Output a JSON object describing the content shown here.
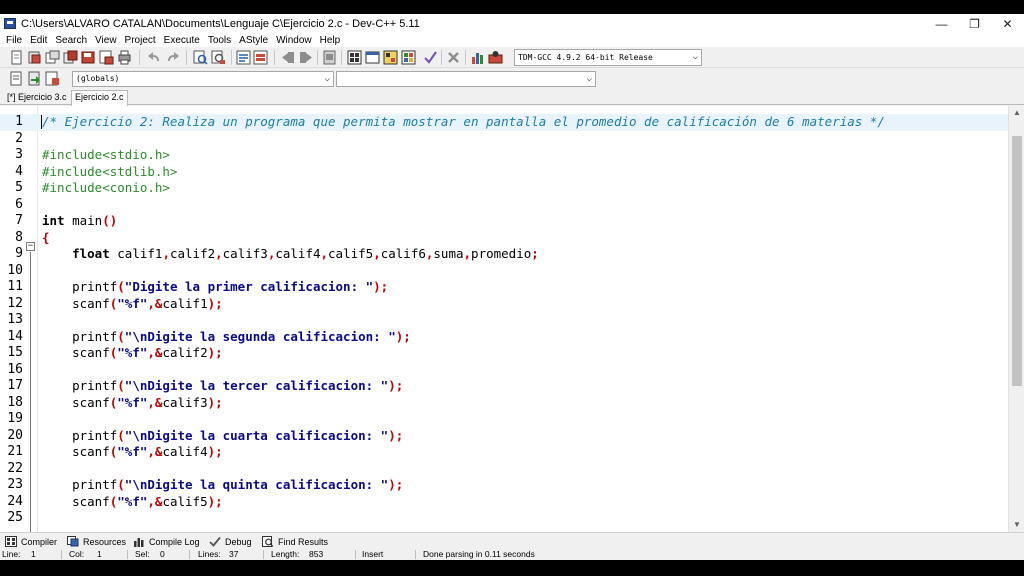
{
  "window": {
    "title": "C:\\Users\\ALVARO CATALAN\\Documents\\Lenguaje C\\Ejercicio 2.c - Dev-C++ 5.11",
    "minimize": "—",
    "maximize": "❐",
    "close": "✕"
  },
  "menu": [
    "File",
    "Edit",
    "Search",
    "View",
    "Project",
    "Execute",
    "Tools",
    "AStyle",
    "Window",
    "Help"
  ],
  "toolbar": {
    "compiler": "TDM-GCC 4.9.2 64-bit Release",
    "scope_combo": "(globals)",
    "member_combo": ""
  },
  "tabs": [
    {
      "label": "[*] Ejercicio 3.c",
      "active": false
    },
    {
      "label": "Ejercicio 2.c",
      "active": true
    }
  ],
  "editor": {
    "current_line": 1,
    "lines": [
      {
        "n": "1",
        "segs": [
          [
            "comment",
            "/* Ejercicio 2: Realiza un programa que permita mostrar en pantalla el promedio de calificación de 6 materias */"
          ]
        ]
      },
      {
        "n": "2",
        "segs": []
      },
      {
        "n": "3",
        "segs": [
          [
            "prep",
            "#include<stdio.h>"
          ]
        ]
      },
      {
        "n": "4",
        "segs": [
          [
            "prep",
            "#include<stdlib.h>"
          ]
        ]
      },
      {
        "n": "5",
        "segs": [
          [
            "prep",
            "#include<conio.h>"
          ]
        ]
      },
      {
        "n": "6",
        "segs": []
      },
      {
        "n": "7",
        "segs": [
          [
            "kw",
            "int"
          ],
          [
            "plain",
            " main"
          ],
          [
            "sym",
            "()"
          ]
        ]
      },
      {
        "n": "8",
        "segs": [
          [
            "sym",
            "{"
          ]
        ]
      },
      {
        "n": "9",
        "segs": [
          [
            "plain",
            "    "
          ],
          [
            "kw",
            "float"
          ],
          [
            "plain",
            " calif1"
          ],
          [
            "sym",
            ","
          ],
          [
            "plain",
            "calif2"
          ],
          [
            "sym",
            ","
          ],
          [
            "plain",
            "calif3"
          ],
          [
            "sym",
            ","
          ],
          [
            "plain",
            "calif4"
          ],
          [
            "sym",
            ","
          ],
          [
            "plain",
            "calif5"
          ],
          [
            "sym",
            ","
          ],
          [
            "plain",
            "calif6"
          ],
          [
            "sym",
            ","
          ],
          [
            "plain",
            "suma"
          ],
          [
            "sym",
            ","
          ],
          [
            "plain",
            "promedio"
          ],
          [
            "sym",
            ";"
          ]
        ]
      },
      {
        "n": "10",
        "segs": []
      },
      {
        "n": "11",
        "segs": [
          [
            "plain",
            "    printf"
          ],
          [
            "sym",
            "("
          ],
          [
            "str",
            "\"Digite la primer calificacion: \""
          ],
          [
            "sym",
            ");"
          ]
        ]
      },
      {
        "n": "12",
        "segs": [
          [
            "plain",
            "    scanf"
          ],
          [
            "sym",
            "("
          ],
          [
            "str",
            "\"%f\""
          ],
          [
            "sym",
            ",&"
          ],
          [
            "plain",
            "calif1"
          ],
          [
            "sym",
            ");"
          ]
        ]
      },
      {
        "n": "13",
        "segs": []
      },
      {
        "n": "14",
        "segs": [
          [
            "plain",
            "    printf"
          ],
          [
            "sym",
            "("
          ],
          [
            "str",
            "\"\\nDigite la segunda calificacion: \""
          ],
          [
            "sym",
            ");"
          ]
        ]
      },
      {
        "n": "15",
        "segs": [
          [
            "plain",
            "    scanf"
          ],
          [
            "sym",
            "("
          ],
          [
            "str",
            "\"%f\""
          ],
          [
            "sym",
            ",&"
          ],
          [
            "plain",
            "calif2"
          ],
          [
            "sym",
            ");"
          ]
        ]
      },
      {
        "n": "16",
        "segs": []
      },
      {
        "n": "17",
        "segs": [
          [
            "plain",
            "    printf"
          ],
          [
            "sym",
            "("
          ],
          [
            "str",
            "\"\\nDigite la tercer calificacion: \""
          ],
          [
            "sym",
            ");"
          ]
        ]
      },
      {
        "n": "18",
        "segs": [
          [
            "plain",
            "    scanf"
          ],
          [
            "sym",
            "("
          ],
          [
            "str",
            "\"%f\""
          ],
          [
            "sym",
            ",&"
          ],
          [
            "plain",
            "calif3"
          ],
          [
            "sym",
            ");"
          ]
        ]
      },
      {
        "n": "19",
        "segs": []
      },
      {
        "n": "20",
        "segs": [
          [
            "plain",
            "    printf"
          ],
          [
            "sym",
            "("
          ],
          [
            "str",
            "\"\\nDigite la cuarta calificacion: \""
          ],
          [
            "sym",
            ");"
          ]
        ]
      },
      {
        "n": "21",
        "segs": [
          [
            "plain",
            "    scanf"
          ],
          [
            "sym",
            "("
          ],
          [
            "str",
            "\"%f\""
          ],
          [
            "sym",
            ",&"
          ],
          [
            "plain",
            "calif4"
          ],
          [
            "sym",
            ");"
          ]
        ]
      },
      {
        "n": "22",
        "segs": []
      },
      {
        "n": "23",
        "segs": [
          [
            "plain",
            "    printf"
          ],
          [
            "sym",
            "("
          ],
          [
            "str",
            "\"\\nDigite la quinta calificacion: \""
          ],
          [
            "sym",
            ");"
          ]
        ]
      },
      {
        "n": "24",
        "segs": [
          [
            "plain",
            "    scanf"
          ],
          [
            "sym",
            "("
          ],
          [
            "str",
            "\"%f\""
          ],
          [
            "sym",
            ",&"
          ],
          [
            "plain",
            "calif5"
          ],
          [
            "sym",
            ");"
          ]
        ]
      },
      {
        "n": "25",
        "segs": []
      }
    ]
  },
  "bottom_tabs": [
    {
      "label": "Compiler",
      "icon": "grid-icon"
    },
    {
      "label": "Resources",
      "icon": "resources-icon"
    },
    {
      "label": "Compile Log",
      "icon": "chart-icon"
    },
    {
      "label": "Debug",
      "icon": "check-icon"
    },
    {
      "label": "Find Results",
      "icon": "find-icon"
    }
  ],
  "status": {
    "line_label": "Line:",
    "line": "1",
    "col_label": "Col:",
    "col": "1",
    "sel_label": "Sel:",
    "sel": "0",
    "lines_label": "Lines:",
    "lines": "37",
    "length_label": "Length:",
    "length": "853",
    "mode": "Insert",
    "message": "Done parsing in 0.11 seconds"
  },
  "colors": {
    "comment": "#1e7ea8",
    "preprocessor": "#2d8b2d",
    "symbol": "#c00000",
    "string": "#0a0a8a",
    "current_line": "#e8f3fc"
  }
}
